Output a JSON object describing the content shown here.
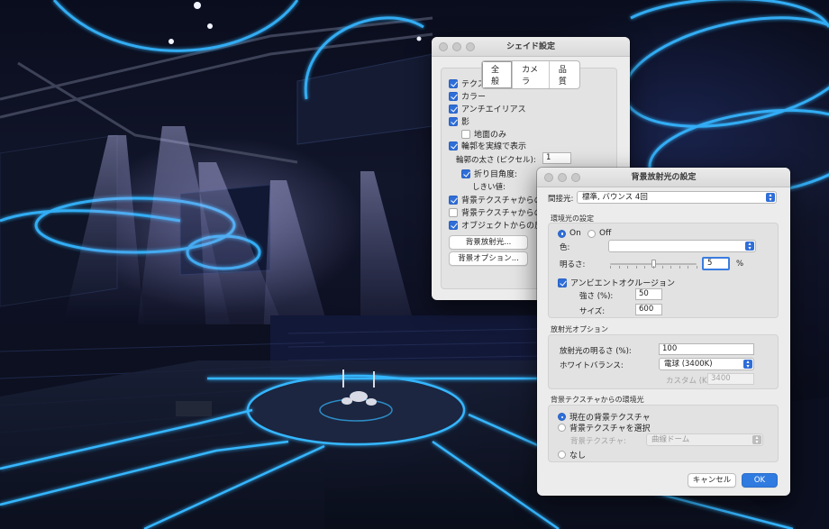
{
  "shade_window": {
    "title": "シェイド設定",
    "tabs": [
      {
        "label": "全般",
        "active": true
      },
      {
        "label": "カメラ",
        "active": false
      },
      {
        "label": "品質",
        "active": false
      }
    ],
    "options": [
      {
        "label": "テクスチャ",
        "checked": true
      },
      {
        "label": "カラー",
        "checked": true
      },
      {
        "label": "アンチエイリアス",
        "checked": true
      },
      {
        "label": "影",
        "checked": true
      },
      {
        "label": "地面のみ",
        "checked": false
      },
      {
        "label": "輪郭を実線で表示",
        "checked": true
      }
    ],
    "outline_width_label": "輪郭の太さ (ピクセル):",
    "outline_width_value": "1",
    "crease_angle_label": "折り目角度:",
    "threshold_label": "しきい値:",
    "env_options": [
      {
        "label": "背景テクスチャからの環",
        "checked": true
      },
      {
        "label": "背景テクスチャからの反",
        "checked": false
      },
      {
        "label": "オブジェクトからの反射",
        "checked": true
      }
    ],
    "bg_light_button": "背景放射光...",
    "bg_options_button": "背景オプション..."
  },
  "bg_window": {
    "title": "背景放射光の設定",
    "indirect_label": "間接光:",
    "indirect_value": "標準, バウンス 4回",
    "ambient_section": "環境光の設定",
    "on_label": "On",
    "off_label": "Off",
    "ambient_on": true,
    "color_label": "色:",
    "brightness_label": "明るさ:",
    "brightness_value": "5",
    "brightness_unit": "%",
    "brightness_level": 0.5,
    "ao_label": "アンビエントオクルージョン",
    "ao_checked": true,
    "strength_label": "強さ (%):",
    "strength_value": "50",
    "size_label": "サイズ:",
    "size_value": "600",
    "emission_section": "放射光オプション",
    "emission_brightness_label": "放射光の明るさ (%):",
    "emission_brightness_value": "100",
    "white_balance_label": "ホワイトバランス:",
    "white_balance_value": "電球 (3400K)",
    "custom_label": "カスタム (K):",
    "custom_value": "3400",
    "env_texture_section": "背景テクスチャからの環境光",
    "radio_current": "現在の背景テクスチャ",
    "radio_select": "背景テクスチャを選択",
    "bg_texture_label": "背景テクスチャ:",
    "bg_texture_value": "曲線ドーム",
    "radio_none": "なし",
    "cancel_label": "キャンセル",
    "ok_label": "OK"
  },
  "colors": {
    "accent": "#2f6ed8",
    "neon": "#35b6ff",
    "scene_dark": "#0a0d1d"
  }
}
